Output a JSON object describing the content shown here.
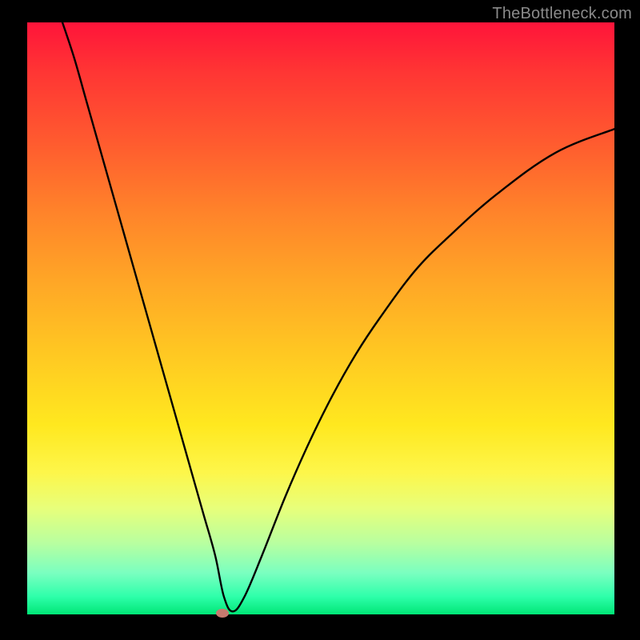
{
  "watermark": "TheBottleneck.com",
  "chart_data": {
    "type": "line",
    "title": "",
    "xlabel": "",
    "ylabel": "",
    "xlim": [
      0,
      100
    ],
    "ylim": [
      0,
      100
    ],
    "series": [
      {
        "name": "curve",
        "x": [
          6,
          8,
          10,
          12,
          14,
          16,
          18,
          20,
          22,
          24,
          26,
          28,
          30,
          32,
          33.5,
          35,
          37,
          40,
          44,
          48,
          52,
          56,
          60,
          66,
          72,
          80,
          90,
          100
        ],
        "y": [
          100,
          94,
          87,
          80,
          73,
          66,
          59,
          52,
          45,
          38,
          31,
          24,
          17,
          10,
          3,
          0.5,
          3,
          10,
          20,
          29,
          37,
          44,
          50,
          58,
          64,
          71,
          78,
          82
        ]
      }
    ],
    "marker": {
      "x": 33.2,
      "y": 0.3
    },
    "gradient_theme": "bottleneck"
  }
}
